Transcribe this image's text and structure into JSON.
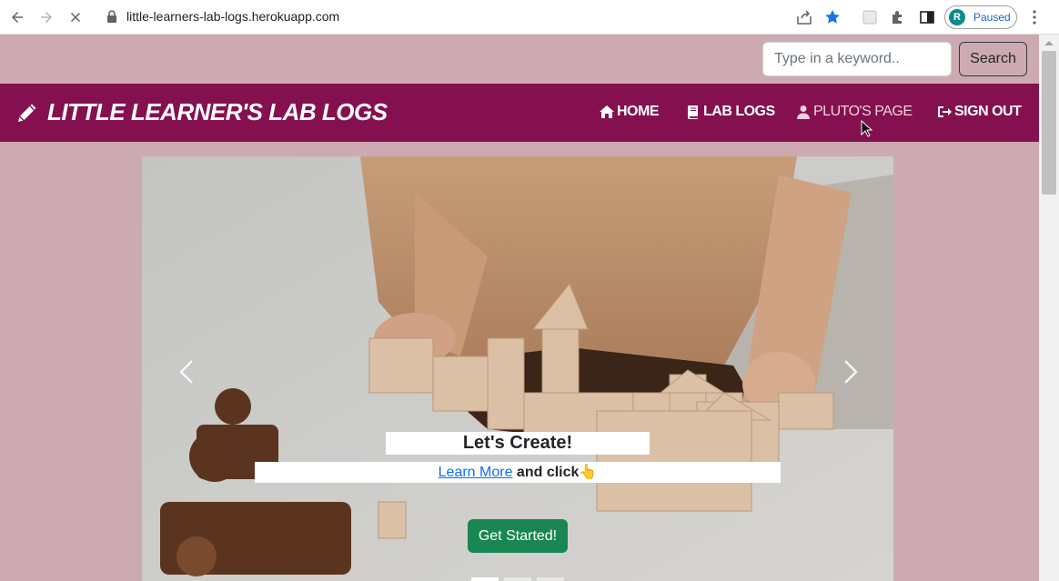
{
  "browser": {
    "url": "little-learners-lab-logs.herokuapp.com",
    "profile_initial": "R",
    "profile_label": "Paused",
    "icons": [
      "back-icon",
      "forward-icon",
      "stop-icon",
      "lock-icon",
      "share-icon",
      "star-icon",
      "extension-icon",
      "puzzle-icon",
      "sidebar-icon",
      "kebab-menu-icon"
    ]
  },
  "search": {
    "placeholder": "Type in a keyword..",
    "button_label": "Search"
  },
  "navbar": {
    "brand": "LITTLE LEARNER'S LAB LOGS",
    "brand_icon": "pencil-icon",
    "background": "#85104f",
    "links": [
      {
        "label": "HOME",
        "icon": "home-icon"
      },
      {
        "label": "LAB LOGS",
        "icon": "book-icon"
      },
      {
        "label": "PLUTO'S PAGE",
        "icon": "user-icon"
      },
      {
        "label": "SIGN OUT",
        "icon": "sign-out-icon"
      }
    ]
  },
  "carousel": {
    "title": "Let's Create!",
    "learn_more": "Learn More",
    "subtitle_rest": " and click👆",
    "cta": "Get Started!",
    "cta_color": "#198754",
    "slides": 3,
    "active_slide": 1
  },
  "colors": {
    "page_background": "#cdaab1",
    "link": "#0d6efd"
  }
}
